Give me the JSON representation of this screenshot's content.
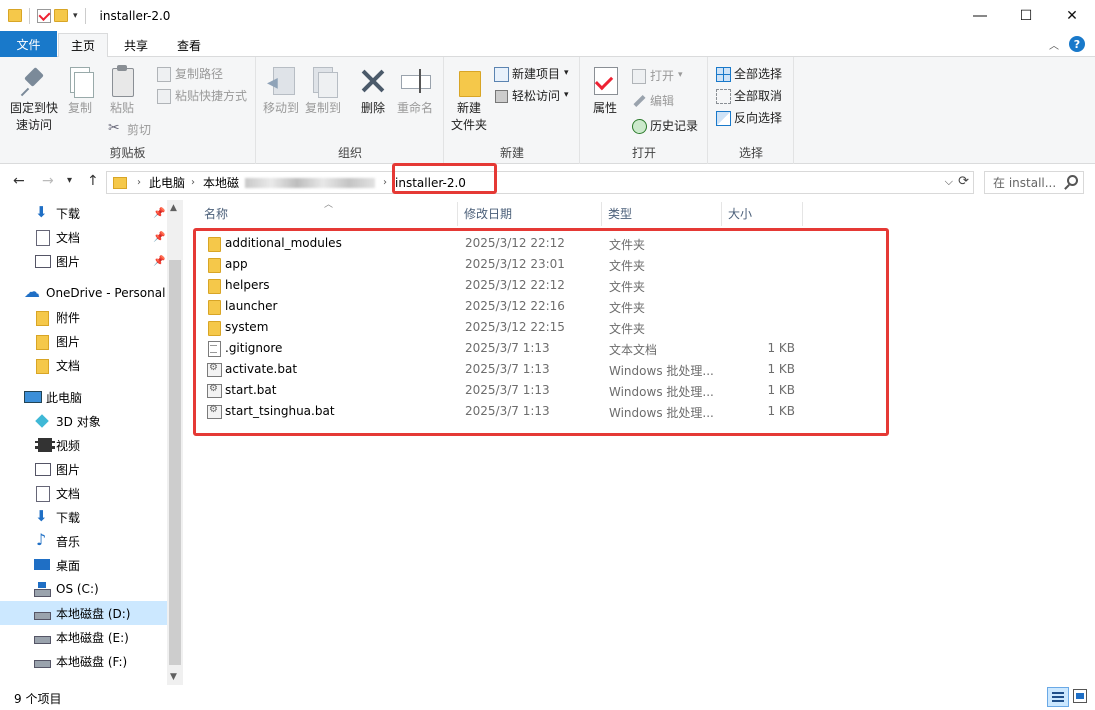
{
  "window": {
    "title": "installer-2.0",
    "min_icon": "minimize-icon",
    "max_icon": "maximize-icon",
    "close_icon": "close-icon"
  },
  "ribbon_tabs": {
    "file": "文件",
    "home": "主页",
    "share": "共享",
    "view": "查看"
  },
  "ribbon": {
    "clipboard": {
      "label": "剪贴板",
      "pin_quick_access": "固定到快\n速访问",
      "pin_line1": "固定到快",
      "pin_line2": "速访问",
      "copy": "复制",
      "paste": "粘贴",
      "copy_path": "复制路径",
      "paste_shortcut": "粘贴快捷方式",
      "cut": "剪切"
    },
    "organize": {
      "label": "组织",
      "move_to": "移动到",
      "copy_to": "复制到",
      "delete": "删除",
      "rename": "重命名"
    },
    "new": {
      "label": "新建",
      "new_folder_line1": "新建",
      "new_folder_line2": "文件夹",
      "new_item": "新建项目",
      "easy_access": "轻松访问"
    },
    "open": {
      "label": "打开",
      "properties": "属性",
      "open": "打开",
      "edit": "编辑",
      "history": "历史记录"
    },
    "select": {
      "label": "选择",
      "select_all": "全部选择",
      "select_none": "全部取消",
      "invert": "反向选择"
    }
  },
  "address": {
    "crumbs": [
      "此电脑",
      "本地磁",
      "installer-2.0"
    ],
    "search_placeholder": "在 install..."
  },
  "nav": {
    "quick": [
      {
        "label": "下载",
        "icon": "download-icon"
      },
      {
        "label": "文档",
        "icon": "documents-icon"
      },
      {
        "label": "图片",
        "icon": "pictures-icon"
      }
    ],
    "onedrive": "OneDrive - Personal",
    "onedrive_items": [
      "附件",
      "图片",
      "文档"
    ],
    "thispc": "此电脑",
    "pc_items": [
      {
        "label": "3D 对象",
        "icon": "3d-objects-icon"
      },
      {
        "label": "视频",
        "icon": "videos-icon"
      },
      {
        "label": "图片",
        "icon": "pictures-icon"
      },
      {
        "label": "文档",
        "icon": "documents-icon"
      },
      {
        "label": "下载",
        "icon": "download-icon"
      },
      {
        "label": "音乐",
        "icon": "music-icon"
      },
      {
        "label": "桌面",
        "icon": "desktop-icon"
      },
      {
        "label": "OS (C:)",
        "icon": "os-drive-icon"
      },
      {
        "label": "本地磁盘 (D:)",
        "icon": "drive-icon"
      },
      {
        "label": "本地磁盘 (E:)",
        "icon": "drive-icon"
      },
      {
        "label": "本地磁盘 (F:)",
        "icon": "drive-icon"
      }
    ]
  },
  "columns": {
    "name": "名称",
    "date": "修改日期",
    "type": "类型",
    "size": "大小"
  },
  "files": [
    {
      "name": "additional_modules",
      "date": "2025/3/12 22:12",
      "type": "文件夹",
      "size": "",
      "icon": "folder"
    },
    {
      "name": "app",
      "date": "2025/3/12 23:01",
      "type": "文件夹",
      "size": "",
      "icon": "folder"
    },
    {
      "name": "helpers",
      "date": "2025/3/12 22:12",
      "type": "文件夹",
      "size": "",
      "icon": "folder"
    },
    {
      "name": "launcher",
      "date": "2025/3/12 22:16",
      "type": "文件夹",
      "size": "",
      "icon": "folder"
    },
    {
      "name": "system",
      "date": "2025/3/12 22:15",
      "type": "文件夹",
      "size": "",
      "icon": "folder"
    },
    {
      "name": ".gitignore",
      "date": "2025/3/7 1:13",
      "type": "文本文档",
      "size": "1 KB",
      "icon": "text"
    },
    {
      "name": "activate.bat",
      "date": "2025/3/7 1:13",
      "type": "Windows 批处理...",
      "size": "1 KB",
      "icon": "bat"
    },
    {
      "name": "start.bat",
      "date": "2025/3/7 1:13",
      "type": "Windows 批处理...",
      "size": "1 KB",
      "icon": "bat"
    },
    {
      "name": "start_tsinghua.bat",
      "date": "2025/3/7 1:13",
      "type": "Windows 批处理...",
      "size": "1 KB",
      "icon": "bat"
    }
  ],
  "status": {
    "count": "9 个项目"
  },
  "colors": {
    "accent": "#1979ca",
    "highlight_box": "#e53935",
    "selected_nav": "#cce8ff"
  }
}
